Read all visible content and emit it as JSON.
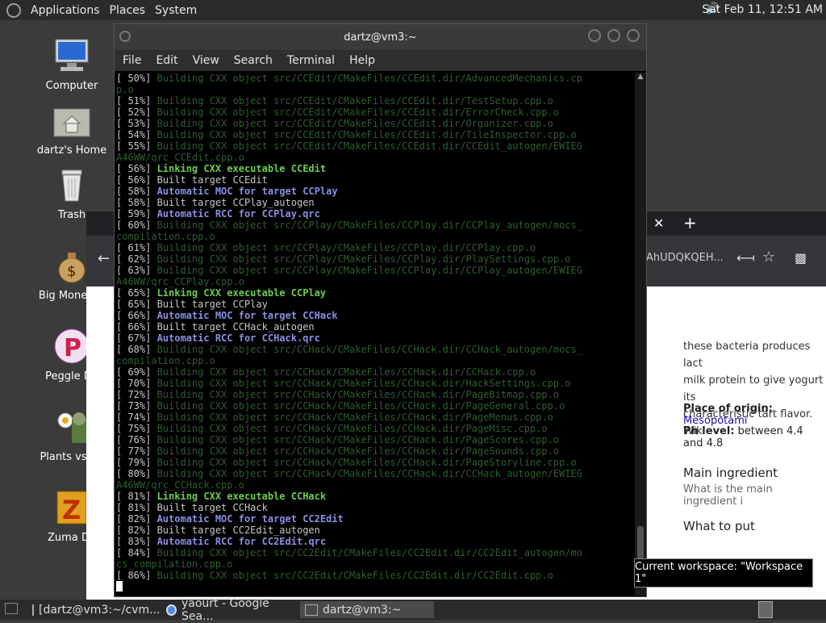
{
  "top_panel": {
    "menus": [
      "Applications",
      "Places",
      "System"
    ],
    "clock": "Sat Feb 11, 12:51 AM"
  },
  "desktop_icons": [
    {
      "label": "Computer"
    },
    {
      "label": "dartz's Home"
    },
    {
      "label": "Trash"
    },
    {
      "label": "Big Money D"
    },
    {
      "label": "Peggle De"
    },
    {
      "label": "Plants vs Zo"
    },
    {
      "label": "Zuma De"
    }
  ],
  "terminal": {
    "title": "dartz@vm3:~",
    "menu": [
      "File",
      "Edit",
      "View",
      "Search",
      "Terminal",
      "Help"
    ],
    "lines": [
      {
        "pct": "[ 50%]",
        "text": " Building CXX object src/CCEdit/CMakeFiles/CCEdit.dir/AdvancedMechanics.cp",
        "style": "build"
      },
      {
        "pct": "",
        "text": "p.o",
        "style": "build"
      },
      {
        "pct": "[ 51%]",
        "text": " Building CXX object src/CCEdit/CMakeFiles/CCEdit.dir/TestSetup.cpp.o",
        "style": "build"
      },
      {
        "pct": "[ 52%]",
        "text": " Building CXX object src/CCEdit/CMakeFiles/CCEdit.dir/ErrorCheck.cpp.o",
        "style": "build"
      },
      {
        "pct": "[ 53%]",
        "text": " Building CXX object src/CCEdit/CMakeFiles/CCEdit.dir/Organizer.cpp.o",
        "style": "build"
      },
      {
        "pct": "[ 54%]",
        "text": " Building CXX object src/CCEdit/CMakeFiles/CCEdit.dir/TileInspector.cpp.o",
        "style": "build"
      },
      {
        "pct": "[ 55%]",
        "text": " Building CXX object src/CCEdit/CMakeFiles/CCEdit.dir/CCEdit_autogen/EWIEG",
        "style": "build"
      },
      {
        "pct": "",
        "text": "A46WW/qrc_CCEdit.cpp.o",
        "style": "build"
      },
      {
        "pct": "[ 56%]",
        "text": " Linking CXX executable CCEdit",
        "style": "link"
      },
      {
        "pct": "[ 56%]",
        "text": " Built target CCEdit",
        "style": "built"
      },
      {
        "pct": "[ 58%]",
        "text": " Automatic MOC for target CCPlay",
        "style": "auto"
      },
      {
        "pct": "[ 58%]",
        "text": " Built target CCPlay_autogen",
        "style": "built"
      },
      {
        "pct": "[ 59%]",
        "text": " Automatic RCC for CCPlay.qrc",
        "style": "auto"
      },
      {
        "pct": "[ 60%]",
        "text": " Building CXX object src/CCPlay/CMakeFiles/CCPlay.dir/CCPlay_autogen/mocs_",
        "style": "build"
      },
      {
        "pct": "",
        "text": "compilation.cpp.o",
        "style": "build"
      },
      {
        "pct": "[ 61%]",
        "text": " Building CXX object src/CCPlay/CMakeFiles/CCPlay.dir/CCPlay.cpp.o",
        "style": "build"
      },
      {
        "pct": "[ 62%]",
        "text": " Building CXX object src/CCPlay/CMakeFiles/CCPlay.dir/PlaySettings.cpp.o",
        "style": "build"
      },
      {
        "pct": "[ 63%]",
        "text": " Building CXX object src/CCPlay/CMakeFiles/CCPlay.dir/CCPlay_autogen/EWIEG",
        "style": "build"
      },
      {
        "pct": "",
        "text": "A46WW/qrc_CCPlay.cpp.o",
        "style": "build"
      },
      {
        "pct": "[ 65%]",
        "text": " Linking CXX executable CCPlay",
        "style": "link"
      },
      {
        "pct": "[ 65%]",
        "text": " Built target CCPlay",
        "style": "built"
      },
      {
        "pct": "[ 66%]",
        "text": " Automatic MOC for target CCHack",
        "style": "auto"
      },
      {
        "pct": "[ 66%]",
        "text": " Built target CCHack_autogen",
        "style": "built"
      },
      {
        "pct": "[ 67%]",
        "text": " Automatic RCC for CCHack.qrc",
        "style": "auto"
      },
      {
        "pct": "[ 68%]",
        "text": " Building CXX object src/CCHack/CMakeFiles/CCHack.dir/CCHack_autogen/mocs_",
        "style": "build"
      },
      {
        "pct": "",
        "text": "compilation.cpp.o",
        "style": "build"
      },
      {
        "pct": "[ 69%]",
        "text": " Building CXX object src/CCHack/CMakeFiles/CCHack.dir/CCHack.cpp.o",
        "style": "build"
      },
      {
        "pct": "[ 70%]",
        "text": " Building CXX object src/CCHack/CMakeFiles/CCHack.dir/HackSettings.cpp.o",
        "style": "build"
      },
      {
        "pct": "[ 72%]",
        "text": " Building CXX object src/CCHack/CMakeFiles/CCHack.dir/PageBitmap.cpp.o",
        "style": "build"
      },
      {
        "pct": "[ 73%]",
        "text": " Building CXX object src/CCHack/CMakeFiles/CCHack.dir/PageGeneral.cpp.o",
        "style": "build"
      },
      {
        "pct": "[ 74%]",
        "text": " Building CXX object src/CCHack/CMakeFiles/CCHack.dir/PageMenus.cpp.o",
        "style": "build"
      },
      {
        "pct": "[ 75%]",
        "text": " Building CXX object src/CCHack/CMakeFiles/CCHack.dir/PageMisc.cpp.o",
        "style": "build"
      },
      {
        "pct": "[ 76%]",
        "text": " Building CXX object src/CCHack/CMakeFiles/CCHack.dir/PageScores.cpp.o",
        "style": "build"
      },
      {
        "pct": "[ 77%]",
        "text": " Building CXX object src/CCHack/CMakeFiles/CCHack.dir/PageSounds.cpp.o",
        "style": "build"
      },
      {
        "pct": "[ 79%]",
        "text": " Building CXX object src/CCHack/CMakeFiles/CCHack.dir/PageStoryline.cpp.o",
        "style": "build"
      },
      {
        "pct": "[ 80%]",
        "text": " Building CXX object src/CCHack/CMakeFiles/CCHack.dir/CCHack_autogen/EWIEG",
        "style": "build"
      },
      {
        "pct": "",
        "text": "A46WW/qrc_CCHack.cpp.o",
        "style": "build"
      },
      {
        "pct": "[ 81%]",
        "text": " Linking CXX executable CCHack",
        "style": "link"
      },
      {
        "pct": "[ 81%]",
        "text": " Built target CCHack",
        "style": "built"
      },
      {
        "pct": "[ 82%]",
        "text": " Automatic MOC for target CC2Edit",
        "style": "auto"
      },
      {
        "pct": "[ 82%]",
        "text": " Built target CC2Edit_autogen",
        "style": "built"
      },
      {
        "pct": "[ 83%]",
        "text": " Automatic RCC for CC2Edit.qrc",
        "style": "auto"
      },
      {
        "pct": "[ 84%]",
        "text": " Building CXX object src/CC2Edit/CMakeFiles/CC2Edit.dir/CC2Edit_autogen/mo",
        "style": "build"
      },
      {
        "pct": "",
        "text": "cs_compilation.cpp.o",
        "style": "build"
      },
      {
        "pct": "[ 86%]",
        "text": " Building CXX object src/CC2Edit/CMakeFiles/CC2Edit.dir/CC2Edit.cpp.o",
        "style": "build"
      }
    ]
  },
  "browser": {
    "url_fragment": "AhUDQKQEH...",
    "side_text": [
      "these bacteria produces lact",
      "milk protein to give yogurt its",
      "characteristic tart flavor. Wik"
    ],
    "place_label": "Place of origin:",
    "place_value": "Mesopotami",
    "ph_label": "Ph level:",
    "ph_value": "between 4.4 and 4.8",
    "main_ingredient": "Main ingredient",
    "main_ingredient_q": "What is the main ingredient i",
    "what_to_put": "What to put"
  },
  "tooltip": "Current workspace: \"Workspace 1\"",
  "taskbar": [
    {
      "label": "[dartz@vm3:~/cvm..."
    },
    {
      "label": "yaourt - Google Sea..."
    },
    {
      "label": "dartz@vm3:~"
    }
  ]
}
